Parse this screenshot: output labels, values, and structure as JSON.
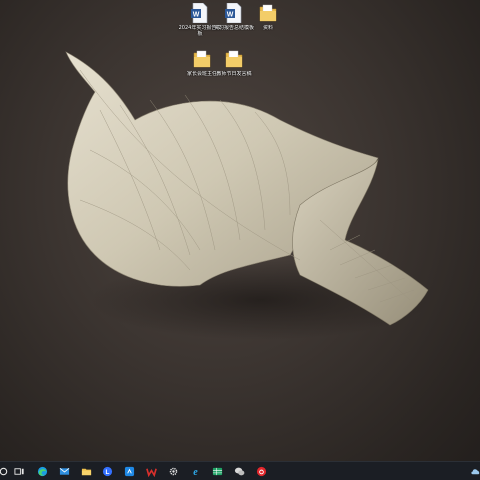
{
  "desktop": {
    "icons": [
      {
        "label": "2024年实习报告模板",
        "type": "word-doc"
      },
      {
        "label": "实习报告总结模板",
        "type": "word-doc"
      },
      {
        "label": "资料",
        "type": "folder"
      },
      {
        "label": "家长会班主任",
        "type": "folder"
      },
      {
        "label": "教师节日发言稿",
        "type": "folder"
      }
    ]
  },
  "taskbar": {
    "items": [
      {
        "name": "search",
        "icon": "search-icon"
      },
      {
        "name": "task-view",
        "icon": "task-view-icon"
      },
      {
        "name": "edge",
        "icon": "edge-icon"
      },
      {
        "name": "mail",
        "icon": "mail-icon"
      },
      {
        "name": "file-explorer",
        "icon": "folder-icon"
      },
      {
        "name": "lark",
        "icon": "lark-icon"
      },
      {
        "name": "app-blue",
        "icon": "app-icon"
      },
      {
        "name": "wps",
        "icon": "wps-icon"
      },
      {
        "name": "settings",
        "icon": "gear-icon"
      },
      {
        "name": "ie",
        "icon": "internet-explorer-icon"
      },
      {
        "name": "spreadsheet",
        "icon": "spreadsheet-icon"
      },
      {
        "name": "wechat",
        "icon": "wechat-icon"
      },
      {
        "name": "netease-music",
        "icon": "netease-music-icon"
      },
      {
        "name": "tray-cloud",
        "icon": "cloud-icon"
      }
    ]
  },
  "colors": {
    "taskbar": "#1b1e24",
    "word": "#2b5797",
    "folder": "#e8b94a",
    "wps_red": "#d9302c",
    "edge": "#1b9de2",
    "wechat": "#2dc100",
    "netease": "#e2262b"
  }
}
